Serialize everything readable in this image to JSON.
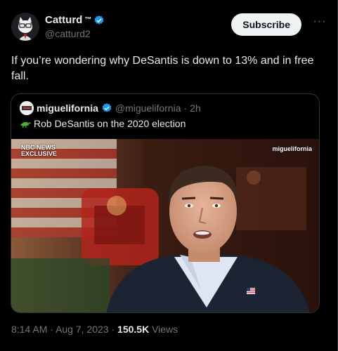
{
  "author": {
    "display_name": "Catturd",
    "tm": "™",
    "handle": "@catturd2",
    "verified": true
  },
  "actions": {
    "subscribe_label": "Subscribe",
    "more_label": "···"
  },
  "tweet": {
    "text": "If you’re wondering why DeSantis is down to 13% and in free fall."
  },
  "quote": {
    "display_name": "miguelifornia",
    "handle": "@miguelifornia",
    "time_sep": "·",
    "time": "2h",
    "text": "Rob DeSantis on the 2020 election",
    "media": {
      "nbc_line1": "NBC NEWS",
      "nbc_line2": "EXCLUSIVE",
      "watermark": "miguelifornia"
    }
  },
  "meta": {
    "time": "8:14 AM",
    "sep1": "·",
    "date": "Aug 7, 2023",
    "sep2": "·",
    "views_count": "150.5K",
    "views_label": "Views"
  },
  "colors": {
    "verified": "#1d9bf0",
    "subscribe_bg": "#eff3f4",
    "muted": "#71767b"
  },
  "icons": [
    "cat-avatar-icon",
    "verified-badge-icon",
    "more-icon",
    "alligator-emoji-icon"
  ]
}
